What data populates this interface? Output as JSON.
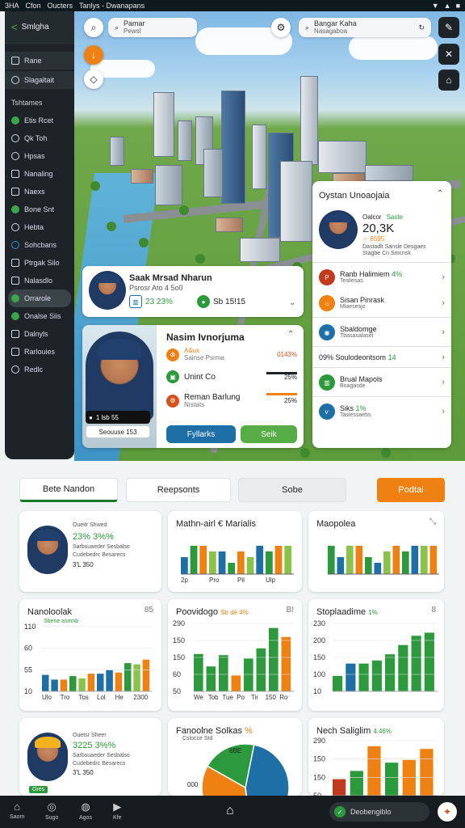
{
  "status": {
    "left": [
      "3HA",
      "Cfon",
      "Oucters",
      "Tanlys - Dwanapans"
    ],
    "right": [
      "▼",
      "▲",
      "■"
    ]
  },
  "sidebar": {
    "header": "Smlgha",
    "top_items": [
      {
        "label": "Rane"
      },
      {
        "label": "Slagaltait"
      }
    ],
    "section_title": "Tshtames",
    "items": [
      {
        "label": "Etis Rcet"
      },
      {
        "label": "Qk Toh"
      },
      {
        "label": "Hpsas"
      },
      {
        "label": "Nanaling"
      },
      {
        "label": "Naexs"
      },
      {
        "label": "Bone Snt"
      },
      {
        "label": "Hebta"
      },
      {
        "label": "Sohcbans"
      },
      {
        "label": "Ptrgak Silo"
      },
      {
        "label": "Nalasdlo"
      },
      {
        "label": "Orrarole"
      },
      {
        "label": "Onalse Siis"
      },
      {
        "label": "Dalnyls"
      },
      {
        "label": "Rarlouies"
      },
      {
        "label": "Redlc"
      }
    ]
  },
  "search1": {
    "title": "Pamar",
    "sub": "Pewsl"
  },
  "search2": {
    "title": "Bangar Kaha",
    "sub": "Nasagaboa"
  },
  "person_card": {
    "name": "Saak Mrsad Nharun",
    "sub": "Psrosr Ato 4 5o0",
    "stat1": "23 23%",
    "stat2": "Sb 15!15"
  },
  "detail_card": {
    "title": "Nasim Ivnorjuma",
    "badge1": "1 lsb 55",
    "badge2": "Seouuse 153",
    "rows": [
      {
        "title": "A&ux",
        "sub": "Sainse Psrma",
        "value": "0143%",
        "color": "#ef8112"
      },
      {
        "title": "Unint Co",
        "sub": "",
        "value": "25%",
        "color": "#2c9a3c"
      },
      {
        "title": "Reman Barlung",
        "sub": "Nrstats",
        "value": "25%",
        "color": "#d4521d"
      }
    ],
    "btn1": "Fyllarks",
    "btn2": "Seik"
  },
  "right_card": {
    "title": "Oystan Unoaojaia",
    "label1": "Oalcor",
    "label2": "Saste",
    "value": "20,3K",
    "value_sub": "☆ 6595",
    "small1": "Dastadlt Sansle Desgaes",
    "small2": "Stagbe Cn Smcnsk",
    "items": [
      {
        "title": "Ranb Halimiem",
        "pct": "4%",
        "sub": "Tesliesas",
        "color": "#c23a1e"
      },
      {
        "title": "Sisan Pinrask",
        "pct": "",
        "sub": "Mlaesesjo",
        "color": "#ef8112"
      },
      {
        "title": "Sbaldomge",
        "pct": "",
        "sub": "Tbasasalasel",
        "color": "#1d6fa5"
      },
      {
        "title": "09% Soulodeontsom",
        "pct": "14",
        "sub": "",
        "color": "#1d6fa5"
      },
      {
        "title": "Brual Mapols",
        "pct": "",
        "sub": "Boagasde",
        "color": "#2c9a3c"
      },
      {
        "title": "Siks",
        "pct": "1%",
        "sub": "Taslessaebs",
        "color": "#1d6fa5"
      }
    ]
  },
  "tabs": [
    {
      "label": "Bete Nandon"
    },
    {
      "label": "Reepsonts"
    },
    {
      "label": "Sobe"
    },
    {
      "label": "Podtai"
    }
  ],
  "panels": {
    "p1": {
      "title": "Oueitr Shwed",
      "value": "23% 3%%",
      "line1": "Sarbsuaeder Sesbalso",
      "line2": "Cudebedrc Besarecs",
      "foot": "3'L 350"
    },
    "p2": {
      "title": "Mathn-airl € Marialis"
    },
    "p3": {
      "title": "Maopolea"
    },
    "p4": {
      "title": "Nanoloolak",
      "legend": "Sbene asmnb",
      "menu": "85"
    },
    "p5": {
      "title": "Poovidogo",
      "highlight": "Sb dé 4%",
      "menu": "B!"
    },
    "p6": {
      "title": "Stoplaadime",
      "highlight": "1%",
      "menu": "8"
    },
    "p7": {
      "title": "Ouetsr Sheer",
      "value": "3225 3%%",
      "line1": "Sarbsuaeder Sesbalso",
      "line2": "Cudebedrc Besarecs",
      "foot": "3'L 350",
      "tag": "Ores"
    },
    "p8": {
      "title": "Fanoolne Solkas",
      "highlight": "%",
      "sub": "Cslocce Std",
      "inner": "6BE"
    },
    "p9": {
      "title": "Nech Saliglim",
      "highlight": "4.46%"
    }
  },
  "bottom_nav": [
    {
      "label": "Saom",
      "icon": "home-icon"
    },
    {
      "label": "Sugo",
      "icon": "gauge-icon"
    },
    {
      "label": "Agos",
      "icon": "person-icon"
    },
    {
      "label": "Kfe",
      "icon": "play-icon"
    }
  ],
  "bottom_status": "Deobengiblo",
  "chart_data": [
    {
      "type": "bar",
      "title": "Mathn-airl € Marialis",
      "categories": [
        "2p",
        "Pro",
        "Pil",
        "Ulp"
      ],
      "series": [
        {
          "name": "",
          "values": [
            3,
            5,
            5,
            4,
            4,
            2,
            4,
            3,
            5,
            4,
            5,
            5
          ]
        }
      ]
    },
    {
      "type": "bar",
      "title": "Maopolea",
      "categories": [
        "",
        "",
        ""
      ],
      "series": [
        {
          "name": "",
          "values": [
            5,
            3,
            5,
            5,
            3,
            2,
            4,
            5,
            4,
            5,
            5,
            5
          ]
        }
      ]
    },
    {
      "type": "bar",
      "title": "Nanoloolak",
      "categories": [
        "Ulo",
        "Tro",
        "Tos",
        "Lol",
        "He",
        "2300"
      ],
      "ylim": [
        10,
        110
      ],
      "yticks": [
        "110",
        "60",
        "55",
        "10"
      ],
      "series": [
        {
          "name": "",
          "values": [
            28,
            20,
            20,
            26,
            22,
            30,
            30,
            36,
            32,
            48,
            46,
            54
          ]
        }
      ]
    },
    {
      "type": "bar",
      "title": "Poovidogo",
      "categories": [
        "We",
        "Tob",
        "Tue",
        "Po",
        "Tir",
        "150",
        "Ro"
      ],
      "ylim": [
        0,
        300
      ],
      "yticks": [
        "290",
        "150",
        "150",
        "60",
        "50"
      ],
      "series": [
        {
          "name": "",
          "values": [
            165,
            110,
            160,
            70,
            145,
            190,
            280,
            240
          ]
        }
      ]
    },
    {
      "type": "bar",
      "title": "Stoplaadime",
      "categories": [],
      "ylim": [
        10,
        230
      ],
      "yticks": [
        "230",
        "200",
        "150",
        "100",
        "10"
      ],
      "series": [
        {
          "name": "",
          "values": [
            60,
            100,
            100,
            110,
            130,
            160,
            190,
            200
          ]
        }
      ]
    },
    {
      "type": "pie",
      "title": "Fanoolne Solkas",
      "series": [
        {
          "name": "",
          "values": [
            45,
            35,
            20
          ]
        }
      ]
    },
    {
      "type": "bar",
      "title": "Nech Saliglim",
      "categories": [],
      "yticks": [
        "290",
        "150",
        "150",
        "50"
      ],
      "series": [
        {
          "name": "",
          "values": [
            60,
            90,
            180,
            120,
            130,
            170
          ]
        }
      ]
    }
  ]
}
